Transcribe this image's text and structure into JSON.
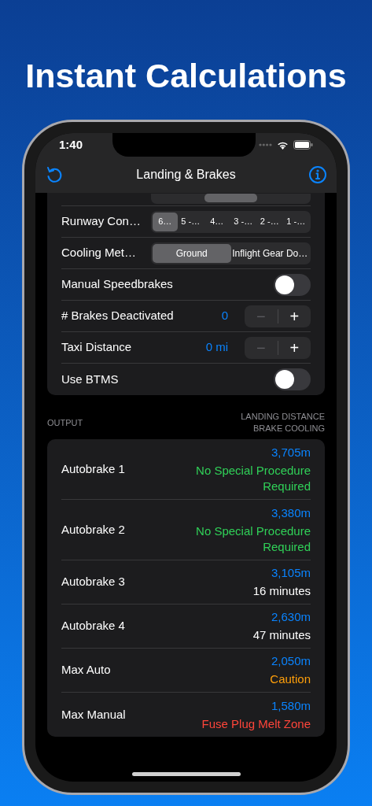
{
  "headline": "Instant Calculations",
  "status_bar": {
    "time": "1:40"
  },
  "nav": {
    "title": "Landing & Brakes"
  },
  "settings": [
    {
      "kind": "segmented",
      "cut": true,
      "segments": [
        {
          "selected": false
        },
        {
          "selected": true
        },
        {
          "selected": false
        }
      ]
    },
    {
      "kind": "segmented",
      "label": "Runway Con…",
      "segments": [
        {
          "label": "6…",
          "selected": true
        },
        {
          "label": "5 -…",
          "selected": false
        },
        {
          "label": "4…",
          "selected": false
        },
        {
          "label": "3 -…",
          "selected": false
        },
        {
          "label": "2 -…",
          "selected": false
        },
        {
          "label": "1 -…",
          "selected": false
        }
      ]
    },
    {
      "kind": "segmented",
      "label": "Cooling Met…",
      "segments": [
        {
          "label": "Ground",
          "selected": true
        },
        {
          "label": "Inflight Gear Do…",
          "selected": false
        }
      ]
    },
    {
      "kind": "toggle",
      "label": "Manual Speedbrakes",
      "on": false
    },
    {
      "kind": "stepper",
      "label": "# Brakes Deactivated",
      "value": "0",
      "buttons": [
        {
          "symbol": "−",
          "disabled": true
        },
        {
          "symbol": "+",
          "disabled": false
        }
      ]
    },
    {
      "kind": "stepper",
      "label": "Taxi Distance",
      "value": "0 mi",
      "buttons": [
        {
          "symbol": "−",
          "disabled": true
        },
        {
          "symbol": "+",
          "disabled": false
        }
      ]
    },
    {
      "kind": "toggle",
      "label": "Use BTMS",
      "on": false
    }
  ],
  "output": {
    "section_label": "OUTPUT",
    "column_labels": [
      "LANDING DISTANCE",
      "BRAKE COOLING"
    ],
    "rows": [
      {
        "label": "Autobrake 1",
        "distance": "3,705m",
        "cooling": "No Special Procedure Required",
        "color": "#30d158"
      },
      {
        "label": "Autobrake 2",
        "distance": "3,380m",
        "cooling": "No Special Procedure Required",
        "color": "#30d158"
      },
      {
        "label": "Autobrake 3",
        "distance": "3,105m",
        "cooling": "16 minutes",
        "color": "#ffffff"
      },
      {
        "label": "Autobrake 4",
        "distance": "2,630m",
        "cooling": "47 minutes",
        "color": "#ffffff"
      },
      {
        "label": "Max Auto",
        "distance": "2,050m",
        "cooling": "Caution",
        "color": "#ff9f0a"
      },
      {
        "label": "Max Manual",
        "distance": "1,580m",
        "cooling": "Fuse Plug Melt Zone",
        "color": "#ff453a"
      }
    ]
  }
}
